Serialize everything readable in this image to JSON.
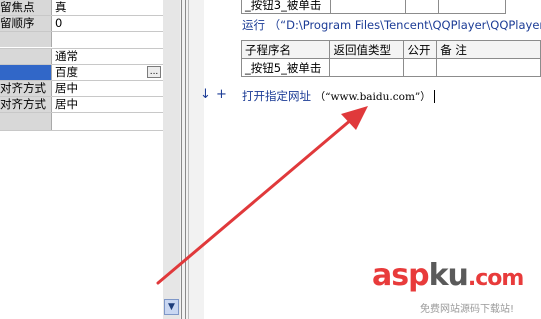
{
  "properties": [
    {
      "name": "留焦点",
      "value": "真"
    },
    {
      "name": "留顺序",
      "value": "0"
    },
    {
      "name": "",
      "value": ""
    },
    {
      "name": "",
      "value": "通常"
    },
    {
      "name": "",
      "value": "百度",
      "selected": true,
      "has_button": true
    },
    {
      "name": "对齐方式",
      "value": "居中"
    },
    {
      "name": "对齐方式",
      "value": "居中"
    }
  ],
  "ellipsis_label": "...",
  "editor": {
    "prev_row": {
      "name": "_按钮3_被单击"
    },
    "run_line": "运行 （“D:\\Program Files\\Tencent\\QQPlayer\\QQPlayer",
    "sub_table": {
      "headers": [
        "子程序名",
        "返回值类型",
        "公开",
        "备 注"
      ],
      "rows": [
        {
          "name": "_按钮5_被单击"
        }
      ]
    },
    "code_cmd": "打开指定网址",
    "code_arg": "（“www.baidu.com”）",
    "margin_arrow": "↓",
    "margin_plus": "+"
  },
  "watermark": {
    "main_a": "asp",
    "main_b": "ku",
    "main_c": ".com",
    "subtitle": "免费网站源码下载站!"
  },
  "colors": {
    "selection": "#3167c8",
    "arrow": "#e0393b",
    "command_text": "#1c3c96"
  }
}
